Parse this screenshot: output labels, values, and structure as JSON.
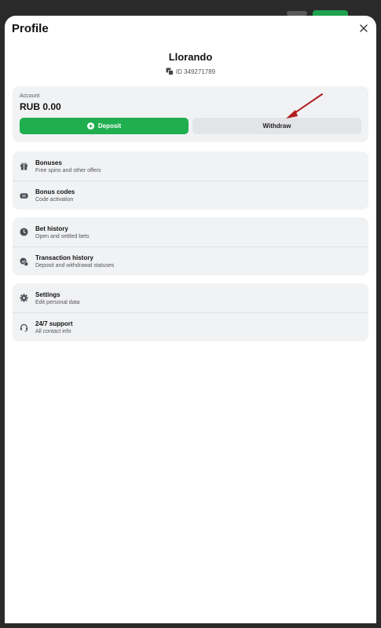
{
  "header": {
    "title": "Profile"
  },
  "user": {
    "name": "Llorando",
    "id": "ID 349271789"
  },
  "account": {
    "label": "Account",
    "balance": "RUB 0.00",
    "deposit_label": "Deposit",
    "withdraw_label": "Withdraw"
  },
  "groups": [
    {
      "items": [
        {
          "title": "Bonuses",
          "subtitle": "Free spins and other offers",
          "icon": "gift-icon"
        },
        {
          "title": "Bonus codes",
          "subtitle": "Code activation",
          "icon": "ticket-icon"
        }
      ]
    },
    {
      "items": [
        {
          "title": "Bet history",
          "subtitle": "Open and settled bets",
          "icon": "clock-icon"
        },
        {
          "title": "Transaction history",
          "subtitle": "Deposit and withdrawal statuses",
          "icon": "transaction-icon"
        }
      ]
    },
    {
      "items": [
        {
          "title": "Settings",
          "subtitle": "Edit personal data",
          "icon": "gear-icon"
        },
        {
          "title": "24/7 support",
          "subtitle": "All contact info",
          "icon": "headset-icon"
        }
      ]
    }
  ],
  "colors": {
    "accent_green": "#1faf4f",
    "annotation_arrow": "#b01c1c"
  }
}
